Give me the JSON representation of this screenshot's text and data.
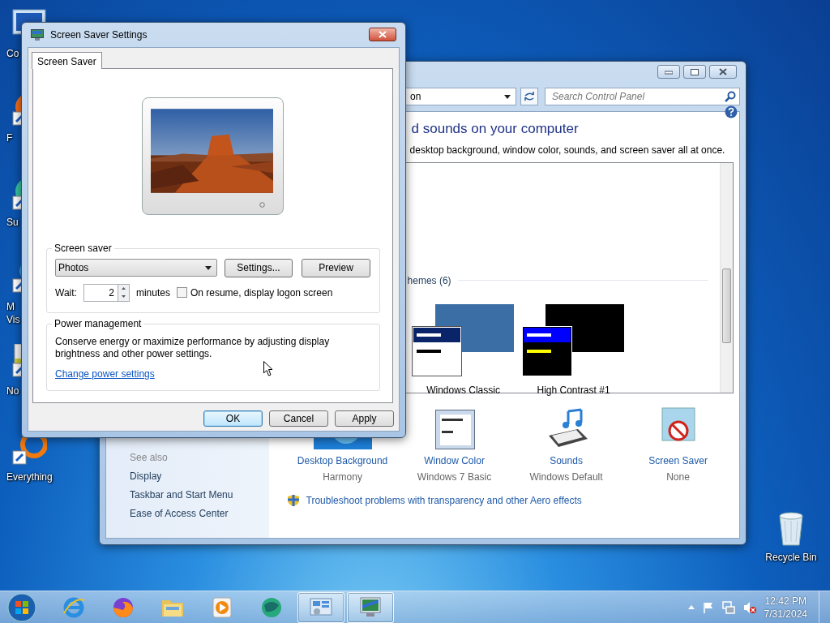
{
  "desktop_icons": [
    {
      "lines": [
        "Co"
      ]
    },
    {
      "lines": [
        "F"
      ]
    },
    {
      "lines": [
        "Su"
      ]
    },
    {
      "lines": [
        "M",
        "Vis"
      ]
    },
    {
      "lines": [
        "No"
      ]
    },
    {
      "lines": [
        "Everything"
      ]
    }
  ],
  "recycle_bin": {
    "label": "Recycle Bin"
  },
  "control_panel": {
    "address": "on",
    "search_placeholder": "Search Control Panel",
    "heading": "d sounds on your computer",
    "subtitle": "desktop background, window color, sounds, and screen saver all at once.",
    "themes_group": "hemes (6)",
    "themes": [
      {
        "name": "Windows Classic",
        "kind": "classic"
      },
      {
        "name": "High Contrast #1",
        "kind": "contrast"
      }
    ],
    "see_also": {
      "title": "See also",
      "links": [
        "Display",
        "Taskbar and Start Menu",
        "Ease of Access Center"
      ]
    },
    "settings": [
      {
        "label": "Desktop Background",
        "value": "Harmony",
        "kind": "wallpaper"
      },
      {
        "label": "Window Color",
        "value": "Windows 7 Basic",
        "kind": "window_color"
      },
      {
        "label": "Sounds",
        "value": "Windows Default",
        "kind": "sounds"
      },
      {
        "label": "Screen Saver",
        "value": "None",
        "kind": "screensaver"
      }
    ],
    "troubleshoot": "Troubleshoot problems with transparency and other Aero effects"
  },
  "dialog": {
    "title": "Screen Saver Settings",
    "tabs": [
      {
        "label": "Screen Saver",
        "selected": true
      }
    ],
    "screen_saver": {
      "legend": "Screen saver",
      "selection": "Photos",
      "buttons": [
        "Settings...",
        "Preview"
      ],
      "wait_label": "Wait:",
      "wait_value": "2",
      "wait_unit": "minutes",
      "logon_checkbox": {
        "label": "On resume, display logon screen",
        "checked": false
      }
    },
    "power": {
      "legend": "Power management",
      "text": "Conserve energy or maximize performance by adjusting display brightness and other power settings.",
      "link": "Change power settings"
    },
    "buttons": [
      {
        "label": "OK",
        "default": true
      },
      {
        "label": "Cancel",
        "default": false
      },
      {
        "label": "Apply",
        "default": false
      }
    ]
  },
  "taskbar": {
    "apps": [
      {
        "kind": "ie",
        "selected": false
      },
      {
        "kind": "firefox",
        "selected": false
      },
      {
        "kind": "explorer",
        "selected": false
      },
      {
        "kind": "media",
        "selected": false
      },
      {
        "kind": "globe",
        "selected": false
      },
      {
        "kind": "control_panel",
        "selected": true
      },
      {
        "kind": "screensaver",
        "selected": true
      }
    ],
    "time": "12:42 PM",
    "date": "7/31/2024"
  }
}
